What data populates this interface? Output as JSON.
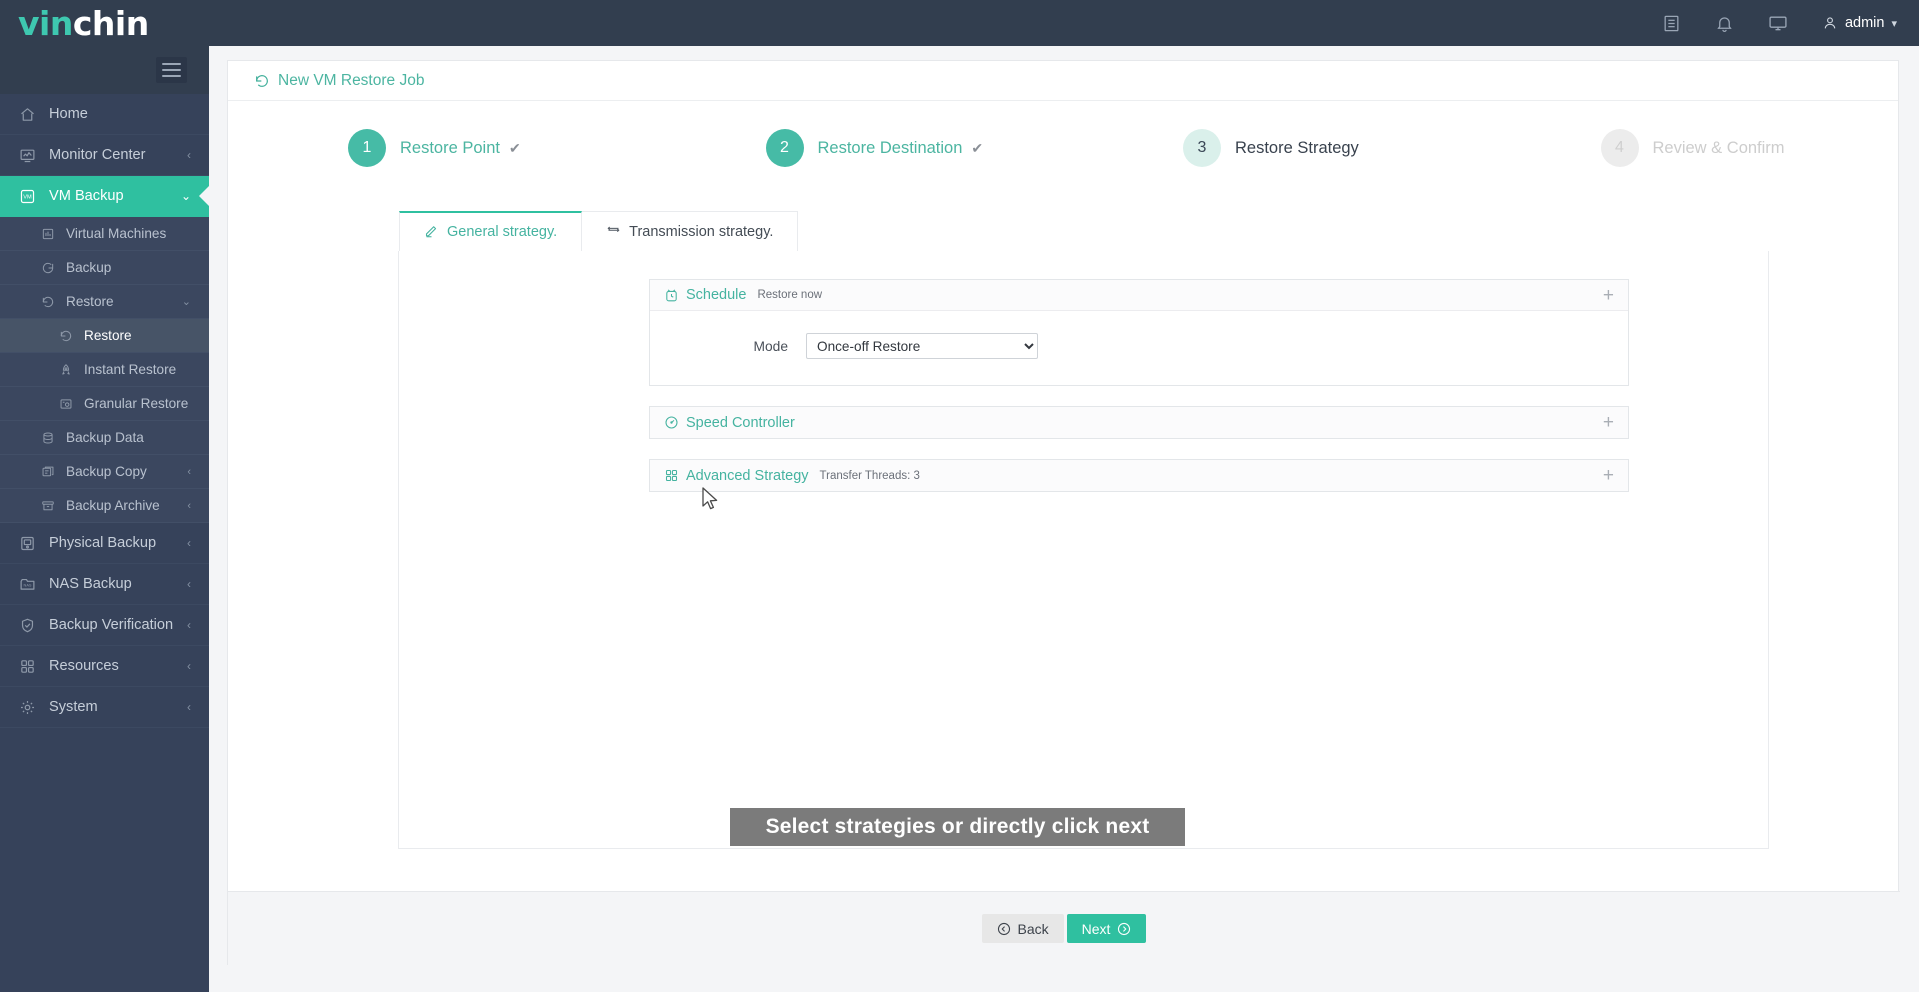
{
  "topbar": {
    "logo_prefix": "vin",
    "logo_suffix": "chin",
    "icons": [
      "document-icon",
      "bell-icon",
      "monitor-icon"
    ],
    "user": "admin"
  },
  "sidebar": {
    "menu_toggle": "hamburger-icon",
    "items": [
      {
        "label": "Home",
        "icon": "home-icon",
        "caret": "",
        "level": 0,
        "state": ""
      },
      {
        "label": "Monitor Center",
        "icon": "monitor-chart-icon",
        "caret": "‹",
        "level": 0,
        "state": ""
      },
      {
        "label": "VM Backup",
        "icon": "vm-icon",
        "caret": "⌄",
        "level": 0,
        "state": "active"
      },
      {
        "label": "Virtual Machines",
        "icon": "chart-icon",
        "caret": "",
        "level": 1,
        "state": ""
      },
      {
        "label": "Backup",
        "icon": "refresh-icon",
        "caret": "",
        "level": 1,
        "state": ""
      },
      {
        "label": "Restore",
        "icon": "restore-icon",
        "caret": "⌄",
        "level": 1,
        "state": ""
      },
      {
        "label": "Restore",
        "icon": "restore-icon",
        "caret": "",
        "level": 2,
        "state": "sel"
      },
      {
        "label": "Instant Restore",
        "icon": "rocket-icon",
        "caret": "",
        "level": 2,
        "state": ""
      },
      {
        "label": "Granular Restore",
        "icon": "granular-icon",
        "caret": "",
        "level": 2,
        "state": ""
      },
      {
        "label": "Backup Data",
        "icon": "database-icon",
        "caret": "",
        "level": 1,
        "state": ""
      },
      {
        "label": "Backup Copy",
        "icon": "copy-icon",
        "caret": "‹",
        "level": 1,
        "state": ""
      },
      {
        "label": "Backup Archive",
        "icon": "archive-icon",
        "caret": "‹",
        "level": 1,
        "state": ""
      },
      {
        "label": "Physical Backup",
        "icon": "server-icon",
        "caret": "‹",
        "level": 0,
        "state": ""
      },
      {
        "label": "NAS Backup",
        "icon": "nas-icon",
        "caret": "‹",
        "level": 0,
        "state": ""
      },
      {
        "label": "Backup Verification",
        "icon": "shield-check-icon",
        "caret": "‹",
        "level": 0,
        "state": ""
      },
      {
        "label": "Resources",
        "icon": "grid-icon",
        "caret": "‹",
        "level": 0,
        "state": ""
      },
      {
        "label": "System",
        "icon": "gear-icon",
        "caret": "‹",
        "level": 0,
        "state": ""
      }
    ]
  },
  "breadcrumb": {
    "icon": "restore-icon",
    "title": "New VM Restore Job"
  },
  "wizard": {
    "steps": [
      {
        "num": "1",
        "label": "Restore Point",
        "state": "done",
        "check": "✔"
      },
      {
        "num": "2",
        "label": "Restore Destination",
        "state": "done",
        "check": "✔"
      },
      {
        "num": "3",
        "label": "Restore Strategy",
        "state": "cur",
        "check": ""
      },
      {
        "num": "4",
        "label": "Review & Confirm",
        "state": "todo",
        "check": ""
      }
    ]
  },
  "tabs": [
    {
      "label": "General strategy.",
      "icon": "pencil-icon",
      "active": true
    },
    {
      "label": "Transmission strategy.",
      "icon": "transfer-icon",
      "active": false
    }
  ],
  "panels": [
    {
      "title": "Schedule",
      "icon": "clock-icon",
      "subtitle": "Restore now",
      "plus": "+",
      "expanded": true,
      "field_label": "Mode",
      "field_value": "Once-off Restore",
      "field_options": [
        "Once-off Restore"
      ]
    },
    {
      "title": "Speed Controller",
      "icon": "speedometer-icon",
      "subtitle": "",
      "plus": "+",
      "expanded": false
    },
    {
      "title": "Advanced Strategy",
      "icon": "grid-icon",
      "subtitle": "Transfer Threads: 3",
      "plus": "+",
      "expanded": false
    }
  ],
  "tooltip": {
    "text": "Select strategies or directly click next"
  },
  "footer": {
    "back_label": "Back",
    "next_label": "Next",
    "back_icon": "arrow-left-circle-icon",
    "next_icon": "arrow-right-circle-icon"
  },
  "colors": {
    "accent": "#2fc0a0",
    "accent_text": "#45b3a0",
    "topbar_bg": "#323e4f",
    "sidebar_bg": "#36425a",
    "page_bg": "#f4f5f7",
    "tooltip_bg": "#7b7b7b"
  }
}
